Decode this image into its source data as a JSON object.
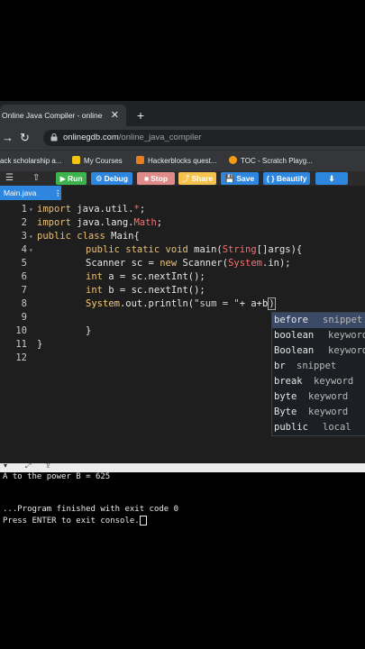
{
  "browser": {
    "tab_title": "Online Java Compiler - online e",
    "tab_close": "✕",
    "new_tab": "+",
    "url_domain": "onlinegdb.com",
    "url_path": "/online_java_compiler"
  },
  "bookmarks": [
    {
      "label": "ack scholarship a...",
      "color": "#e74c3c"
    },
    {
      "label": "My Courses",
      "color": "#f1c40f"
    },
    {
      "label": "Hackerblocks quest...",
      "color": "#e67e22"
    },
    {
      "label": "TOC - Scratch Playg...",
      "color": "#f39c12"
    }
  ],
  "toolbar": {
    "run": "Run",
    "debug": "Debug",
    "stop": "Stop",
    "share": "Share",
    "save": "Save",
    "beautify": "{ } Beautify",
    "colors": {
      "run": "#3cb44b",
      "debug": "#2e86de",
      "stop": "#e08a8a",
      "share": "#f5c24f",
      "save": "#2e86de",
      "beautify": "#2e86de",
      "download": "#2e86de"
    }
  },
  "file_tab": {
    "name": "Main.java",
    "menu": "⋮"
  },
  "editor": {
    "line_numbers": [
      "1",
      "2",
      "3",
      "4",
      "5",
      "6",
      "7",
      "8",
      "9",
      "10",
      "11",
      "12"
    ],
    "lines": {
      "l1_kw": "import",
      "l1_a": " java.util.",
      "l1_b": "*",
      "l1_c": ";",
      "l2_kw": "import",
      "l2_a": " java.lang.",
      "l2_b": "Math",
      "l2_c": ";",
      "l3_kw": "public class",
      "l3_a": " Main{",
      "l4_kw": "public static void",
      "l4_a": " main(",
      "l4_b": "String",
      "l4_c": "[]args){",
      "l5_a": "Scanner sc = ",
      "l5_kw": "new",
      "l5_b": " Scanner(",
      "l5_c": "System",
      "l5_d": ".in);",
      "l6_kw": "int",
      "l6_a": " a = sc.nextInt();",
      "l7_kw": "int",
      "l7_a": " b = sc.nextInt();",
      "l8_a": "System",
      "l8_b": ".out.println(",
      "l8_c": "\"sum = \"",
      "l8_d": "+ a+b",
      "l8_e": ")",
      "l10": "}",
      "l11": "}"
    }
  },
  "autocomplete": [
    {
      "word": "before",
      "kind": "snippet"
    },
    {
      "word": "boolean",
      "kind": "keyword"
    },
    {
      "word": "Boolean",
      "kind": "keyword"
    },
    {
      "word": "br",
      "kind": "snippet"
    },
    {
      "word": "break",
      "kind": "keyword"
    },
    {
      "word": "byte",
      "kind": "keyword"
    },
    {
      "word": "Byte",
      "kind": "keyword"
    },
    {
      "word": "public",
      "kind": "local"
    }
  ],
  "console": {
    "line1": "A to the power B = 625",
    "line2": "...Program finished with exit code 0",
    "line3": "Press ENTER to exit console."
  }
}
